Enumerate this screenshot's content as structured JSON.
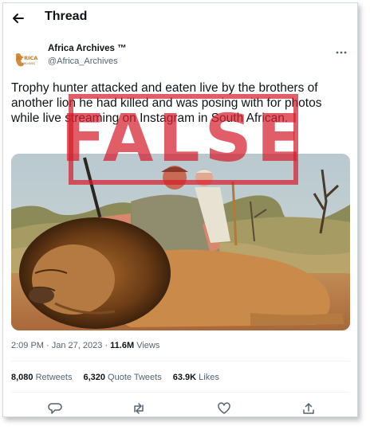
{
  "header": {
    "title": "Thread"
  },
  "author": {
    "name": "Africa Archives ™",
    "handle": "@Africa_Archives",
    "avatar_text": "AFRICA",
    "avatar_subtext": "ARCHIVES"
  },
  "tweet": {
    "text": "Trophy hunter attacked and eaten live by the brothers of another lion he had killed and was posing with for photos while live streaming on Instagram in South African.",
    "stamp": "FALSE",
    "time": "2:09 PM",
    "separator": " · ",
    "date": "Jan 27, 2023",
    "views_count": "11.6M",
    "views_label": " Views"
  },
  "stats": {
    "retweets_count": "8,080",
    "retweets_label": " Retweets",
    "quotes_count": "6,320",
    "quotes_label": " Quote Tweets",
    "likes_count": "63.9K",
    "likes_label": " Likes"
  },
  "icons": {
    "back": "arrow-left-icon",
    "more": "more-horizontal-icon",
    "reply": "reply-icon",
    "retweet": "retweet-icon",
    "like": "heart-icon",
    "share": "share-icon"
  }
}
